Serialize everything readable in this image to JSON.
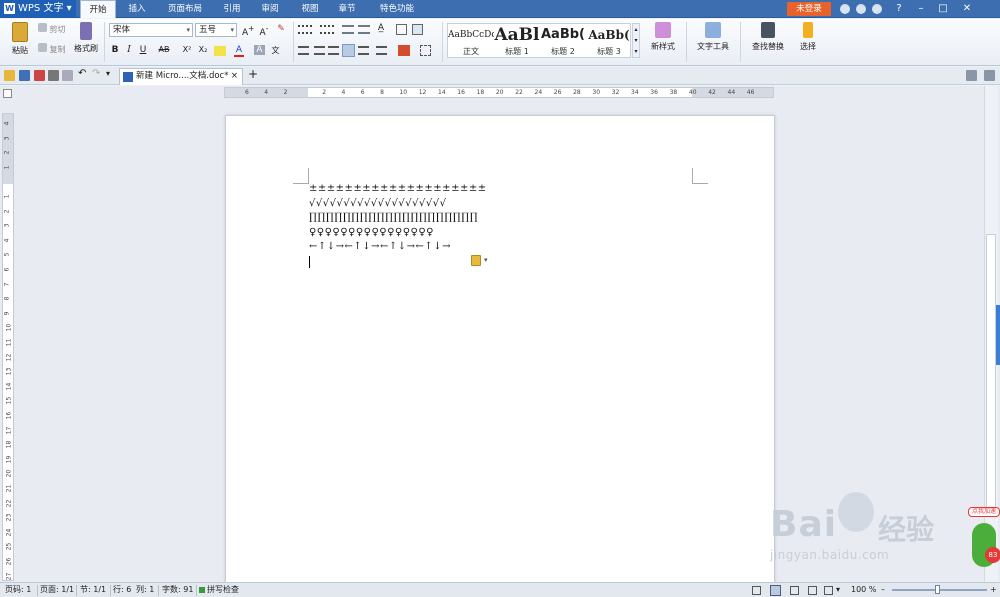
{
  "app": {
    "name": "WPS 文字",
    "login": "未登录"
  },
  "menu_tabs": [
    "开始",
    "插入",
    "页面布局",
    "引用",
    "审阅",
    "视图",
    "章节",
    "特色功能"
  ],
  "title_controls": [
    "?",
    "–",
    "□",
    "✕"
  ],
  "ribbon": {
    "paste": "粘贴",
    "cut": "剪切",
    "copy": "复制",
    "format_painter": "格式刷",
    "font_name": "宋体",
    "font_size": "五号",
    "styles": [
      {
        "preview": "AaBbCcDd",
        "name": "正文"
      },
      {
        "preview": "AaBl",
        "name": "标题 1"
      },
      {
        "preview": "AaBb(",
        "name": "标题 2"
      },
      {
        "preview": "AaBb(",
        "name": "标题 3"
      }
    ],
    "new_style": "新样式",
    "text_tools": "文字工具",
    "find_replace": "查找替换",
    "select": "选择",
    "format_glyphs": {
      "bold": "B",
      "italic": "I",
      "underline": "U",
      "strike": "AB",
      "superscript": "X²",
      "subscript": "X₂",
      "font_color": "A",
      "char_shade": "A",
      "phonetic": "文"
    }
  },
  "doc_tab": {
    "title": "新建 Micro....文档.doc",
    "modified": "*",
    "close": "×",
    "new": "+"
  },
  "ruler": {
    "h": [
      "6",
      "4",
      "2",
      "",
      "2",
      "4",
      "6",
      "8",
      "10",
      "12",
      "14",
      "16",
      "18",
      "20",
      "22",
      "24",
      "26",
      "28",
      "30",
      "32",
      "34",
      "36",
      "38",
      "40",
      "42",
      "44",
      "46"
    ],
    "v": [
      "4",
      "3",
      "2",
      "1",
      "",
      "1",
      "2",
      "3",
      "4",
      "5",
      "6",
      "7",
      "8",
      "9",
      "10",
      "11",
      "12",
      "13",
      "14",
      "15",
      "16",
      "17",
      "18",
      "19",
      "20",
      "21",
      "22",
      "23",
      "24",
      "25",
      "26",
      "27"
    ]
  },
  "document": {
    "lines": [
      "±±±±±±±±±±±±±±±±±±±±",
      "√√√√√√√√√√√√√√√√√√√√",
      "∏∏∏∏∏∏∏∏∏∏∏∏∏∏∏∏∏∏∏∏",
      "♀♀♀♀♀♀♀♀♀♀♀♀♀♀♀♀",
      "←↑↓→←↑↓→←↑↓→←↑↓→"
    ]
  },
  "status": {
    "page_no": "页码: 1",
    "pages": "页面: 1/1",
    "section": "节: 1/1",
    "row": "行: 6",
    "col": "列: 1",
    "words": "字数: 91",
    "spell": "拼写检查",
    "zoom": "100 %"
  },
  "watermark": {
    "brand": "Bai",
    "brand2": "经验",
    "url": "jingyan.baidu.com"
  },
  "badge": {
    "label": "点我加速",
    "num": "83"
  },
  "colors": {
    "title_bg": "#3d6fb0",
    "login_bg": "#e8632c",
    "accent": "#3b7fd4"
  }
}
